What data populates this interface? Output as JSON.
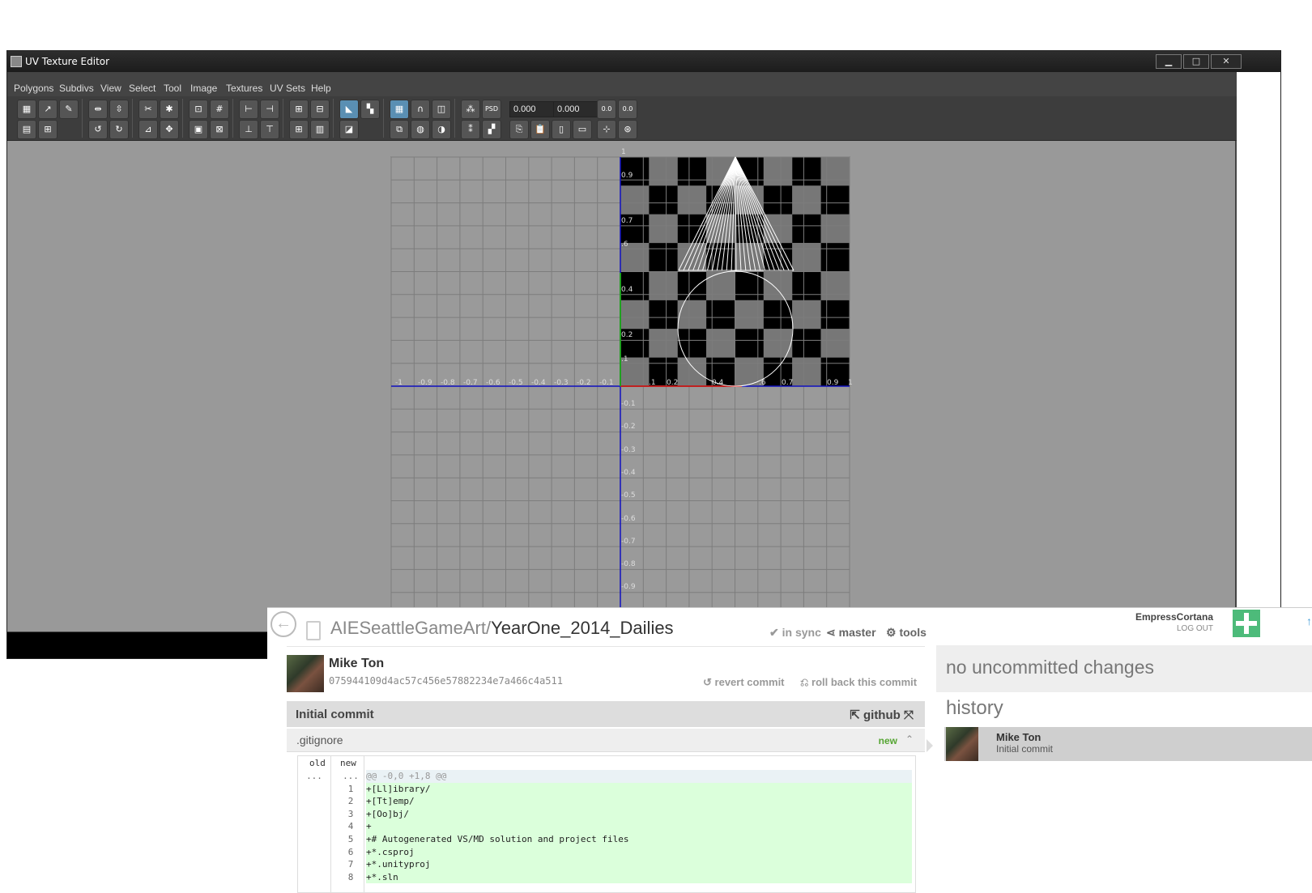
{
  "maya": {
    "title": "UV Texture Editor",
    "menu": [
      "Polygons",
      "Subdivs",
      "View",
      "Select",
      "Tool",
      "Image",
      "Textures",
      "UV Sets",
      "Help"
    ],
    "toolbar": {
      "u_value": "0.000",
      "v_value": "0.000",
      "uv_button": "0.0",
      "uv_button2": "0.0",
      "psd_label": "PSD"
    },
    "window_buttons": {
      "minimize": "▁",
      "maximize": "□",
      "close": "✕"
    },
    "axis": {
      "x_ticks": [
        "-1",
        "-0.9",
        "-0.8",
        "-0.7",
        "-0.6",
        "-0.5",
        "-0.4",
        "-0.3",
        "-0.2",
        "-0.1",
        ".1",
        "0.2",
        "0.4",
        ".6",
        "0.7",
        "0.9",
        "1"
      ],
      "y_ticks": [
        "1",
        "0.9",
        "0.7",
        ".6",
        "0.4",
        "0.2",
        ".1",
        "-0.1",
        "-0.2",
        "-0.3",
        "-0.4",
        "-0.5",
        "-0.6",
        "-0.7",
        "-0.8",
        "-0.9"
      ]
    }
  },
  "github": {
    "repo_owner": "AIESeattleGameArt/",
    "repo_name": "YearOne_2014_Dailies",
    "sync_status": "in sync",
    "branch": "master",
    "tools": "tools",
    "user": "EmpressCortana",
    "logout": "LOG OUT",
    "commit": {
      "author": "Mike Ton",
      "sha": "075944109d4ac57c456e57882234e7a466c4a511",
      "revert": "revert commit",
      "rollback": "roll back this commit",
      "message": "Initial commit",
      "github_link": "github"
    },
    "file": {
      "name": ".gitignore",
      "status": "new",
      "col_old": "old",
      "col_new": "new",
      "hunk_old": "...",
      "hunk_new": "...",
      "hunk": "@@ -0,0 +1,8 @@",
      "lines": [
        {
          "n": "1",
          "code": "+[Ll]ibrary/"
        },
        {
          "n": "2",
          "code": "+[Tt]emp/"
        },
        {
          "n": "3",
          "code": "+[Oo]bj/"
        },
        {
          "n": "4",
          "code": "+"
        },
        {
          "n": "5",
          "code": "+# Autogenerated VS/MD solution and project files"
        },
        {
          "n": "6",
          "code": "+*.csproj"
        },
        {
          "n": "7",
          "code": "+*.unityproj"
        },
        {
          "n": "8",
          "code": "+*.sln"
        }
      ]
    },
    "uncommitted": "no uncommitted changes",
    "history_title": "history",
    "history": [
      {
        "name": "Mike Ton",
        "message": "Initial commit"
      }
    ]
  }
}
